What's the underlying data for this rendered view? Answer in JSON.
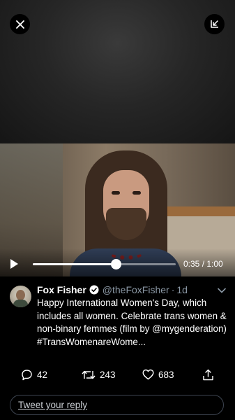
{
  "player": {
    "close_icon": "close-icon",
    "minimize_icon": "minimize-icon",
    "play_icon": "play-icon",
    "progress_fraction": 0.58,
    "time_display": "0:35 / 1:00"
  },
  "tweet": {
    "display_name": "Fox Fisher",
    "verified_icon": "verified-badge-icon",
    "handle": "@theFoxFisher",
    "separator": "·",
    "age": "1d",
    "text_plain": "Happy International Women's Day, which includes all women. Celebrate trans women & non-binary femmes (film by",
    "mention": "@mygenderation",
    "hashtag": "#TransWomenareWome...",
    "more_icon": "chevron-down-icon"
  },
  "actions": {
    "reply_count": "42",
    "retweet_count": "243",
    "like_count": "683",
    "share_icon": "share-icon"
  },
  "reply_box": {
    "placeholder": "Tweet your reply"
  }
}
